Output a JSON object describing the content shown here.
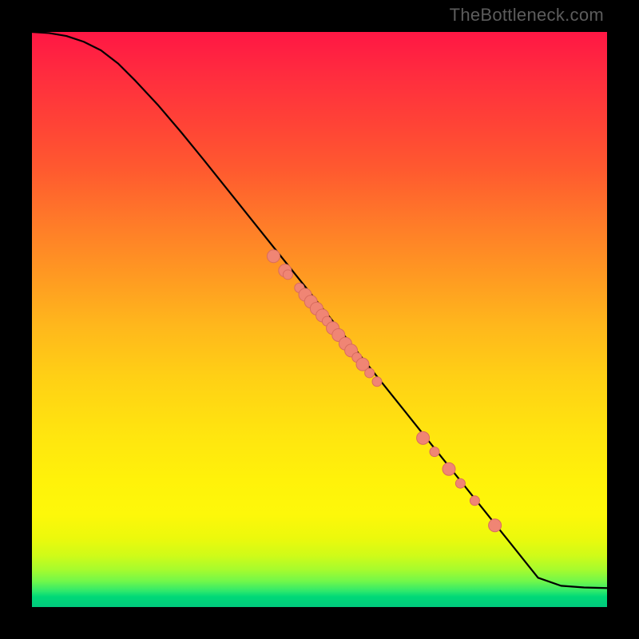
{
  "watermark": "TheBottleneck.com",
  "colors": {
    "background": "#000000",
    "dot_fill": "#f08574",
    "dot_stroke": "#d96c5e",
    "curve": "#000000"
  },
  "chart_data": {
    "type": "line",
    "title": "",
    "xlabel": "",
    "ylabel": "",
    "xlim": [
      0,
      100
    ],
    "ylim": [
      0,
      100
    ],
    "curve": {
      "x": [
        0,
        3,
        6,
        9,
        12,
        15,
        18,
        22,
        26,
        30,
        34,
        38,
        42,
        46,
        50,
        54,
        58,
        62,
        66,
        70,
        74,
        78,
        82,
        86,
        88,
        92,
        96,
        100
      ],
      "y": [
        100,
        99.8,
        99.3,
        98.3,
        96.8,
        94.5,
        91.5,
        87.2,
        82.5,
        77.6,
        72.6,
        67.6,
        62.6,
        57.6,
        52.6,
        47.6,
        42.6,
        37.6,
        32.6,
        27.6,
        22.6,
        17.6,
        12.6,
        7.6,
        5.1,
        3.7,
        3.4,
        3.3
      ]
    },
    "points": {
      "x": [
        42.0,
        44.0,
        44.5,
        46.5,
        47.5,
        48.5,
        49.5,
        50.5,
        51.3,
        52.3,
        53.3,
        54.5,
        55.5,
        56.5,
        57.5,
        58.7,
        60.0,
        68.0,
        70.0,
        72.5,
        74.5,
        77.0,
        80.5
      ],
      "y": [
        61.0,
        58.5,
        57.8,
        55.5,
        54.3,
        53.1,
        51.9,
        50.7,
        49.7,
        48.5,
        47.3,
        45.8,
        44.6,
        43.4,
        42.2,
        40.7,
        39.2,
        29.4,
        27.0,
        24.0,
        21.5,
        18.5,
        14.2
      ],
      "r": [
        8,
        8,
        6,
        6,
        8,
        8,
        8,
        8,
        6,
        8,
        8,
        8,
        8,
        6,
        8,
        6,
        6,
        8,
        6,
        8,
        6,
        6,
        8
      ]
    }
  }
}
